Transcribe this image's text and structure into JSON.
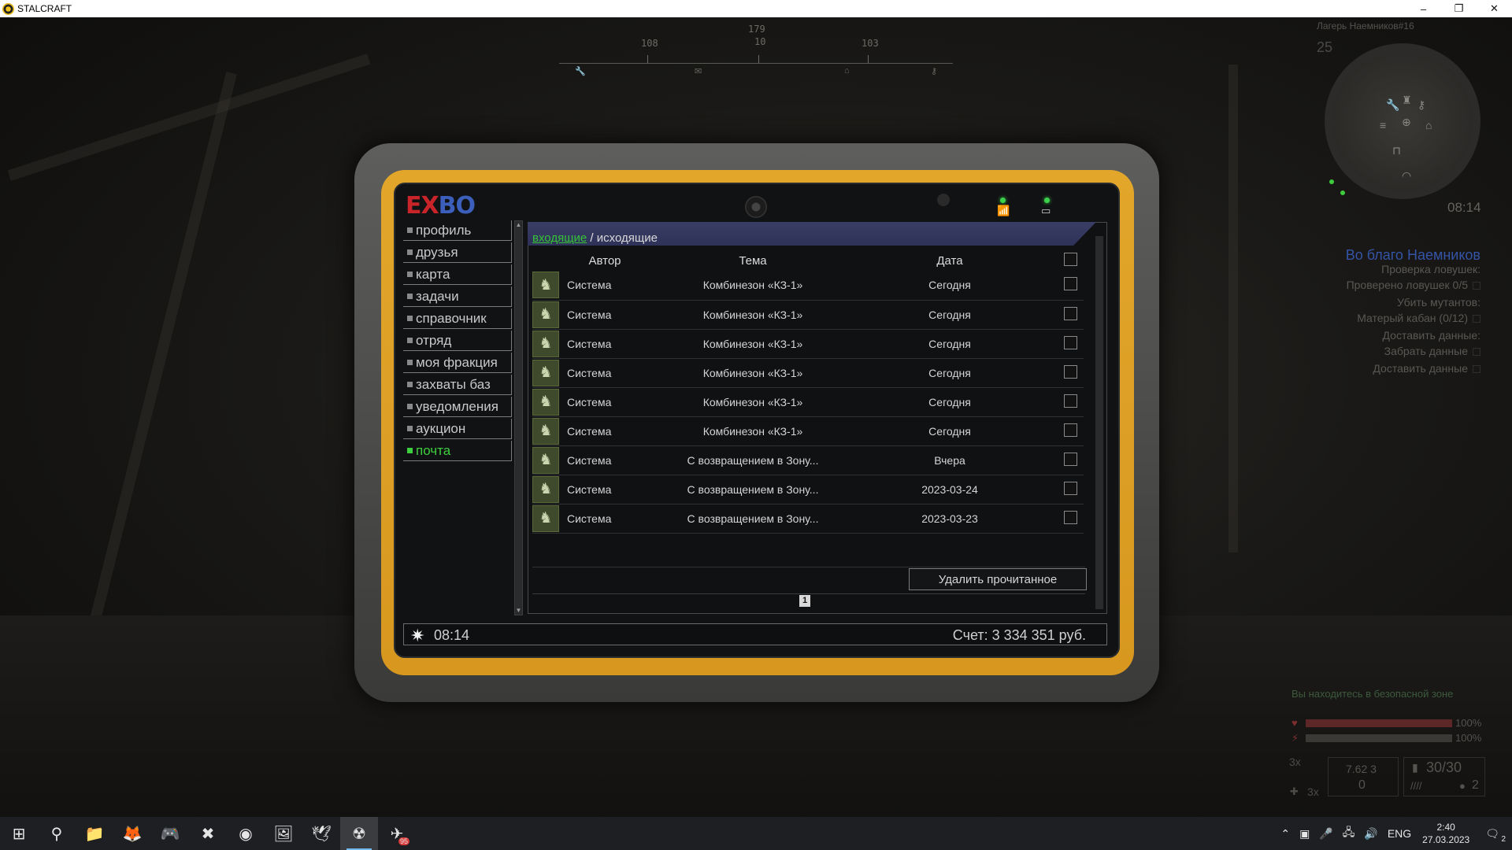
{
  "window": {
    "title": "STALCRAFT",
    "minimize": "–",
    "maximize": "❐",
    "close": "✕"
  },
  "compass": {
    "top": "179",
    "left": "108",
    "center": "10",
    "right": "103"
  },
  "tablet": {
    "brand_left": "EX",
    "brand_right": "BO",
    "status_icons": {
      "signal": "📶",
      "battery": "▭"
    }
  },
  "sidebar": {
    "items": [
      {
        "label": "профиль"
      },
      {
        "label": "друзья"
      },
      {
        "label": "карта"
      },
      {
        "label": "задачи"
      },
      {
        "label": "справочник"
      },
      {
        "label": "отряд"
      },
      {
        "label": "моя фракция"
      },
      {
        "label": "захваты баз"
      },
      {
        "label": "уведомления"
      },
      {
        "label": "аукцион"
      },
      {
        "label": "почта",
        "active": true
      }
    ]
  },
  "mail": {
    "tab_inbox": "входящие",
    "tab_separator": " / ",
    "tab_outbox": "исходящие",
    "headers": {
      "author": "Автор",
      "subject": "Тема",
      "date": "Дата"
    },
    "rows": [
      {
        "author": "Система",
        "subject": "Комбинезон «КЗ-1»",
        "date": "Сегодня"
      },
      {
        "author": "Система",
        "subject": "Комбинезон «КЗ-1»",
        "date": "Сегодня"
      },
      {
        "author": "Система",
        "subject": "Комбинезон «КЗ-1»",
        "date": "Сегодня"
      },
      {
        "author": "Система",
        "subject": "Комбинезон «КЗ-1»",
        "date": "Сегодня"
      },
      {
        "author": "Система",
        "subject": "Комбинезон «КЗ-1»",
        "date": "Сегодня"
      },
      {
        "author": "Система",
        "subject": "Комбинезон «КЗ-1»",
        "date": "Сегодня"
      },
      {
        "author": "Система",
        "subject": "С возвращением в Зону...",
        "date": "Вчера"
      },
      {
        "author": "Система",
        "subject": "С возвращением в Зону...",
        "date": "2023-03-24"
      },
      {
        "author": "Система",
        "subject": "С возвращением в Зону...",
        "date": "2023-03-23"
      }
    ],
    "delete_read_label": "Удалить прочитанное",
    "current_page": "1"
  },
  "bottom_bar": {
    "time": "08:14",
    "balance": "Счет: 3 334 351 руб."
  },
  "minimap": {
    "title": "Лагерь Наемников#16",
    "level": "25",
    "time": "08:14"
  },
  "quests": {
    "title": "Во благо Наемников",
    "lines": [
      "Проверка ловушек:",
      "Проверено ловушек 0/5",
      "Убить мутантов:",
      "Матерый кабан (0/12)",
      "Доставить данные:",
      "Забрать данные",
      "Доставить данные"
    ]
  },
  "hud": {
    "safe_zone": "Вы находитесь в безопасной зоне",
    "health_pct": "100%",
    "stamina_pct": "100%",
    "health_level": 1.0,
    "stamina_level": 1.0,
    "zoom_top": "3x",
    "zoom_bottom": "3x",
    "caliber": "7.62 3",
    "reserve": "0",
    "ammo": "30/30",
    "grenades": "2"
  },
  "taskbar": {
    "apps": [
      {
        "name": "windows-start",
        "glyph": "⊞"
      },
      {
        "name": "search",
        "glyph": "⚲"
      },
      {
        "name": "file-explorer",
        "glyph": "📁"
      },
      {
        "name": "firefox",
        "glyph": "🦊"
      },
      {
        "name": "discord",
        "glyph": "🎮"
      },
      {
        "name": "app-x",
        "glyph": "✖"
      },
      {
        "name": "spotify",
        "glyph": "◉"
      },
      {
        "name": "paint",
        "glyph": "🖼"
      },
      {
        "name": "app-bird",
        "glyph": "🕊"
      },
      {
        "name": "stalcraft",
        "glyph": "☢",
        "active": true
      },
      {
        "name": "telegram",
        "glyph": "✈",
        "badge": "95"
      }
    ],
    "tray": {
      "language": "ENG",
      "time": "2:40",
      "date": "27.03.2023",
      "notifications": "2"
    }
  },
  "colors": {
    "accent_green": "#3ecf3e",
    "tablet_yellow": "#e2a62b",
    "tab_bar": "#3a3e66"
  }
}
